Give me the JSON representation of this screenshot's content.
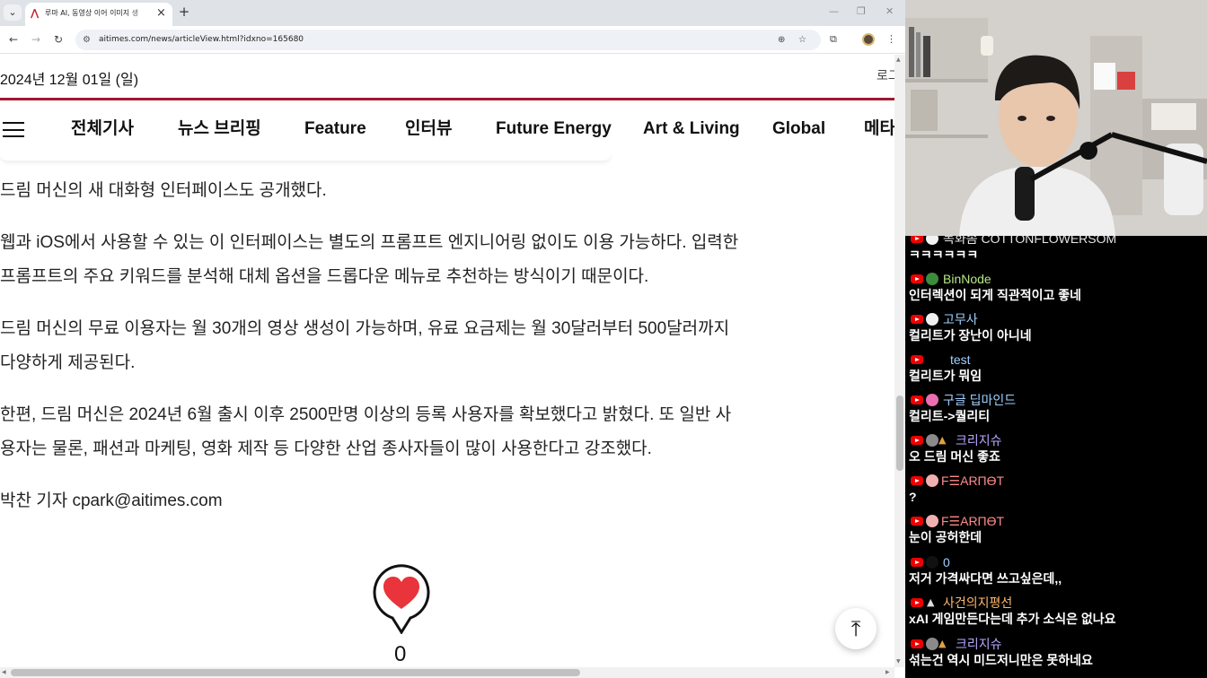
{
  "browser": {
    "tab_title": "루마 AI, 동영상 이어 이미지 생",
    "url": "aitimes.com/news/articleView.html?idxno=165680"
  },
  "page": {
    "date": "2024년 12월 01일 (일)",
    "login": "로그",
    "nav": [
      "전체기사",
      "뉴스 브리핑",
      "Feature",
      "인터뷰",
      "Future Energy",
      "Art & Living",
      "Global",
      "메타"
    ],
    "paragraphs": [
      [
        "드림 머신의 새 대화형 인터페이스도 공개했다."
      ],
      [
        "웹과 iOS에서 사용할 수 있는 이 인터페이스는 별도의 프롬프트 엔지니어링 없이도 이용 가능하다. 입력한",
        "프롬프트의 주요 키워드를 분석해 대체 옵션을 드롭다운 메뉴로 추천하는 방식이기 때문이다."
      ],
      [
        "드림 머신의 무료 이용자는 월 30개의 영상 생성이 가능하며, 유료 요금제는 월 30달러부터 500달러까지",
        "다양하게 제공된다."
      ],
      [
        "한편, 드림 머신은 2024년 6월 출시 이후 2500만명 이상의 등록 사용자를 확보했다고 밝혔다. 또 일반 사",
        "용자는 물론, 패션과 마케팅, 영화 제작 등 다양한 산업 종사자들이 많이 사용한다고 강조했다."
      ]
    ],
    "byline": "박찬 기자 cpark@aitimes.com",
    "like_count": "0"
  },
  "chat": [
    {
      "name": "목화솜 COTTONFLOWERSOM",
      "text": "ㅋㅋㅋㅋㅋㅋ",
      "name_color": "#e6e6e6",
      "avatar_color": "#f2f2f2"
    },
    {
      "name": "BinNode",
      "text": "인터렉션이 되게 직관적이고 좋네",
      "name_color": "#b8e986",
      "avatar_color": "#3d8b3d"
    },
    {
      "name": "고무사",
      "text": "컬리트가 장난이 아니네",
      "name_color": "#9fd0ff",
      "avatar_color": "#f0f0f0"
    },
    {
      "name": "test",
      "text": "컬리트가 뭐임",
      "name_color": "#9fd0ff",
      "avatar_color": "#000000"
    },
    {
      "name": "구글 딥마인드",
      "text": "컬리트->퀄리티",
      "name_color": "#9fd0ff",
      "avatar_color": "#e96fb0"
    },
    {
      "name": "크리지슈",
      "text": "오 드림 머신 좋죠",
      "name_color": "#b9a6ff",
      "avatar_color": "#8a8a8a"
    },
    {
      "name": "F☰ARПƟT",
      "text": "?",
      "name_color": "#ff8a8a",
      "avatar_color": "#f0b0b0"
    },
    {
      "name": "F☰ARПƟT",
      "text": "눈이 공허한데",
      "name_color": "#ff8a8a",
      "avatar_color": "#f0b0b0"
    },
    {
      "name": "0",
      "text": "저거 가격싸다면 쓰고싶은데,,",
      "name_color": "#9fd0ff",
      "avatar_color": "#111111"
    },
    {
      "name": "사건의지평선",
      "text": "xAI 게임만든다는데 추가 소식은 없나요",
      "name_color": "#ffb86c",
      "avatar_color": "#000000"
    },
    {
      "name": "크리지슈",
      "text": "섞는건 역시 미드저니만은 못하네요",
      "name_color": "#b9a6ff",
      "avatar_color": "#8a8a8a"
    }
  ],
  "colors": {
    "brand": "#a01830",
    "like_heart": "#e8343a",
    "chat_bg": "#000000"
  }
}
